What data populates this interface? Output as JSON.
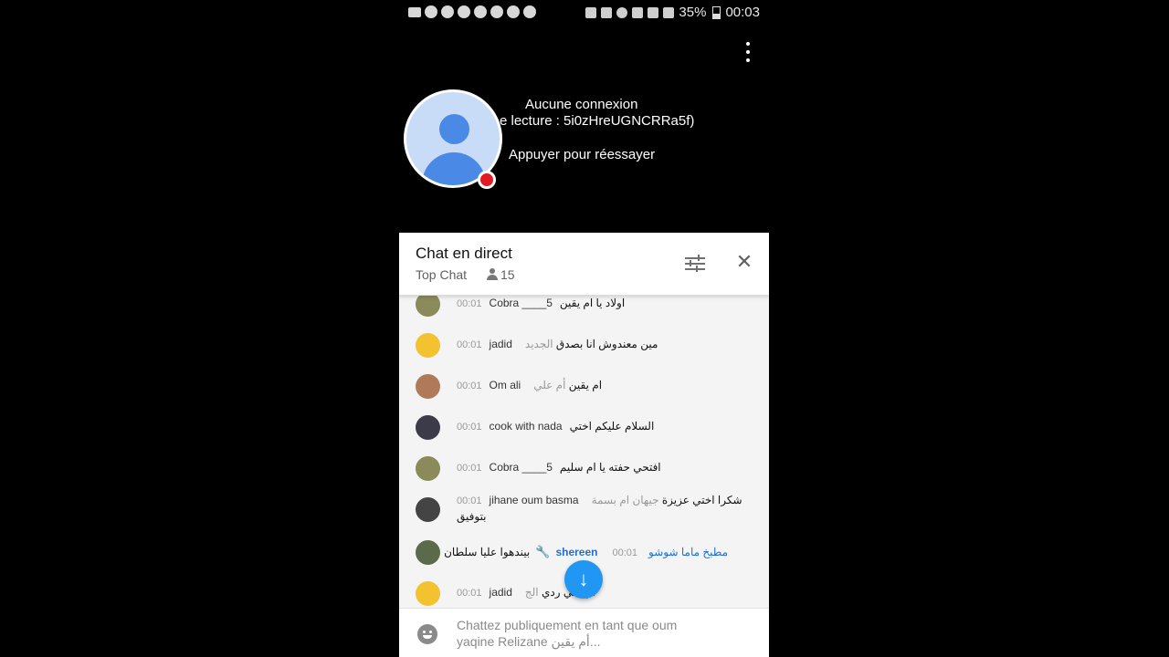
{
  "status_bar": {
    "battery": "35%",
    "time": "00:03"
  },
  "player": {
    "error_title": "Aucune connexion",
    "error_detail": "e lecture : 5i0zHreUGNCRRa5f)",
    "retry_label": "Appuyer pour réessayer"
  },
  "chat": {
    "title": "Chat en direct",
    "mode": "Top Chat",
    "viewer_count": "15",
    "messages": [
      {
        "time": "00:01",
        "author": "Cobra ____5",
        "text": "اولاد يا ام يقين",
        "avatar_color": "#8a8a5a"
      },
      {
        "time": "00:01",
        "author": "jadid",
        "text": "مين معندوش انا بصدق",
        "extra": "الجديد",
        "avatar_color": "#f2c230"
      },
      {
        "time": "00:01",
        "author": "Om ali",
        "text": "ام يقين",
        "extra": "أم علي",
        "avatar_color": "#b07a5a"
      },
      {
        "time": "00:01",
        "author": "cook with nada",
        "text": "السلام عليكم اختي",
        "avatar_color": "#3b3b4a"
      },
      {
        "time": "00:01",
        "author": "Cobra ____5",
        "text": "افتحي حفته يا ام سليم",
        "avatar_color": "#8a8a5a"
      },
      {
        "time": "00:01",
        "author": "jihane oum basma",
        "text": "شكرا اختي عزيزة",
        "extra": "جيهان ام بسمة",
        "text2": "بتوفيق",
        "avatar_color": "#444444"
      },
      {
        "time": "00:01",
        "author": "shereen",
        "text": "بيندهوا عليا سلطان",
        "extra": "مطبخ ماما شوشو",
        "avatar_color": "#5a6a4a"
      },
      {
        "time": "00:01",
        "author": "jadid",
        "text": "ام علي ردي",
        "extra": "الج",
        "avatar_color": "#f2c230"
      }
    ],
    "input_placeholder_line1": "Chattez publiquement en tant que oum",
    "input_placeholder_line2": "yaqine Relizane أم يقين..."
  },
  "icons": [
    "kebab-menu-icon",
    "avatar-icon",
    "tune-icon",
    "close-icon",
    "person-icon",
    "wrench-icon",
    "arrow-down-icon",
    "emoji-icon"
  ],
  "colors": {
    "accent": "#2196f3",
    "live": "#e11b22",
    "moderator": "#1f6fd6"
  }
}
